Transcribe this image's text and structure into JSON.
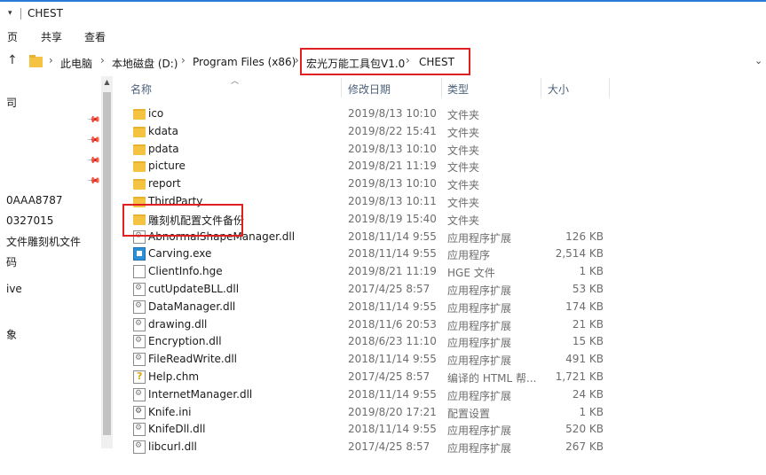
{
  "window": {
    "title": "CHEST"
  },
  "quick_access": {
    "arrow": "▾"
  },
  "ribbon": {
    "tabs": [
      "页",
      "共享",
      "查看"
    ]
  },
  "address": {
    "up_arrow": "↑",
    "separator": "›",
    "crumbs": [
      "此电脑",
      "本地磁盘 (D:)",
      "Program Files (x86)",
      "宏光万能工具包V1.0",
      "CHEST"
    ],
    "dropdown": "⌄"
  },
  "nav": {
    "items": [
      "司",
      "0AAA8787",
      "0327015",
      "文件雕刻机文件",
      "码",
      "ive",
      "象"
    ]
  },
  "columns": {
    "name": "名称",
    "date": "修改日期",
    "type": "类型",
    "size": "大小"
  },
  "files": [
    {
      "name": "ico",
      "date": "2019/8/13 10:10",
      "type": "文件夹",
      "size": "",
      "icon": "folder-icon"
    },
    {
      "name": "kdata",
      "date": "2019/8/22 15:41",
      "type": "文件夹",
      "size": "",
      "icon": "folder-icon"
    },
    {
      "name": "pdata",
      "date": "2019/8/13 10:10",
      "type": "文件夹",
      "size": "",
      "icon": "folder-icon"
    },
    {
      "name": "picture",
      "date": "2019/8/21 11:19",
      "type": "文件夹",
      "size": "",
      "icon": "folder-icon"
    },
    {
      "name": "report",
      "date": "2019/8/13 10:10",
      "type": "文件夹",
      "size": "",
      "icon": "folder-icon"
    },
    {
      "name": "ThirdParty",
      "date": "2019/8/13 10:11",
      "type": "文件夹",
      "size": "",
      "icon": "folder-icon"
    },
    {
      "name": "雕刻机配置文件备份",
      "date": "2019/8/19 15:40",
      "type": "文件夹",
      "size": "",
      "icon": "folder-icon"
    },
    {
      "name": "AbnormalShapeManager.dll",
      "date": "2018/11/14 9:55",
      "type": "应用程序扩展",
      "size": "126 KB",
      "icon": "dll-file-icon"
    },
    {
      "name": "Carving.exe",
      "date": "2018/11/14 9:55",
      "type": "应用程序",
      "size": "2,514 KB",
      "icon": "exe-file-icon"
    },
    {
      "name": "ClientInfo.hge",
      "date": "2019/8/21 11:19",
      "type": "HGE 文件",
      "size": "1 KB",
      "icon": "blank-file-icon"
    },
    {
      "name": "cutUpdateBLL.dll",
      "date": "2017/4/25 8:57",
      "type": "应用程序扩展",
      "size": "53 KB",
      "icon": "dll-file-icon"
    },
    {
      "name": "DataManager.dll",
      "date": "2018/11/14 9:55",
      "type": "应用程序扩展",
      "size": "174 KB",
      "icon": "dll-file-icon"
    },
    {
      "name": "drawing.dll",
      "date": "2018/11/6 20:53",
      "type": "应用程序扩展",
      "size": "21 KB",
      "icon": "dll-file-icon"
    },
    {
      "name": "Encryption.dll",
      "date": "2018/6/23 11:10",
      "type": "应用程序扩展",
      "size": "15 KB",
      "icon": "dll-file-icon"
    },
    {
      "name": "FileReadWrite.dll",
      "date": "2018/11/14 9:55",
      "type": "应用程序扩展",
      "size": "491 KB",
      "icon": "dll-file-icon"
    },
    {
      "name": "Help.chm",
      "date": "2017/4/25 8:57",
      "type": "编译的 HTML 帮...",
      "size": "1,721 KB",
      "icon": "help-file-icon"
    },
    {
      "name": "InternetManager.dll",
      "date": "2018/11/14 9:55",
      "type": "应用程序扩展",
      "size": "24 KB",
      "icon": "dll-file-icon"
    },
    {
      "name": "Knife.ini",
      "date": "2019/8/20 17:21",
      "type": "配置设置",
      "size": "1 KB",
      "icon": "ini-file-icon"
    },
    {
      "name": "KnifeDll.dll",
      "date": "2018/11/14 9:55",
      "type": "应用程序扩展",
      "size": "520 KB",
      "icon": "dll-file-icon"
    },
    {
      "name": "libcurl.dll",
      "date": "2017/4/25 8:57",
      "type": "应用程序扩展",
      "size": "267 KB",
      "icon": "dll-file-icon"
    }
  ],
  "colors": {
    "highlight": "#e02020",
    "folder": "#f4c342",
    "header_text": "#4c607a"
  }
}
